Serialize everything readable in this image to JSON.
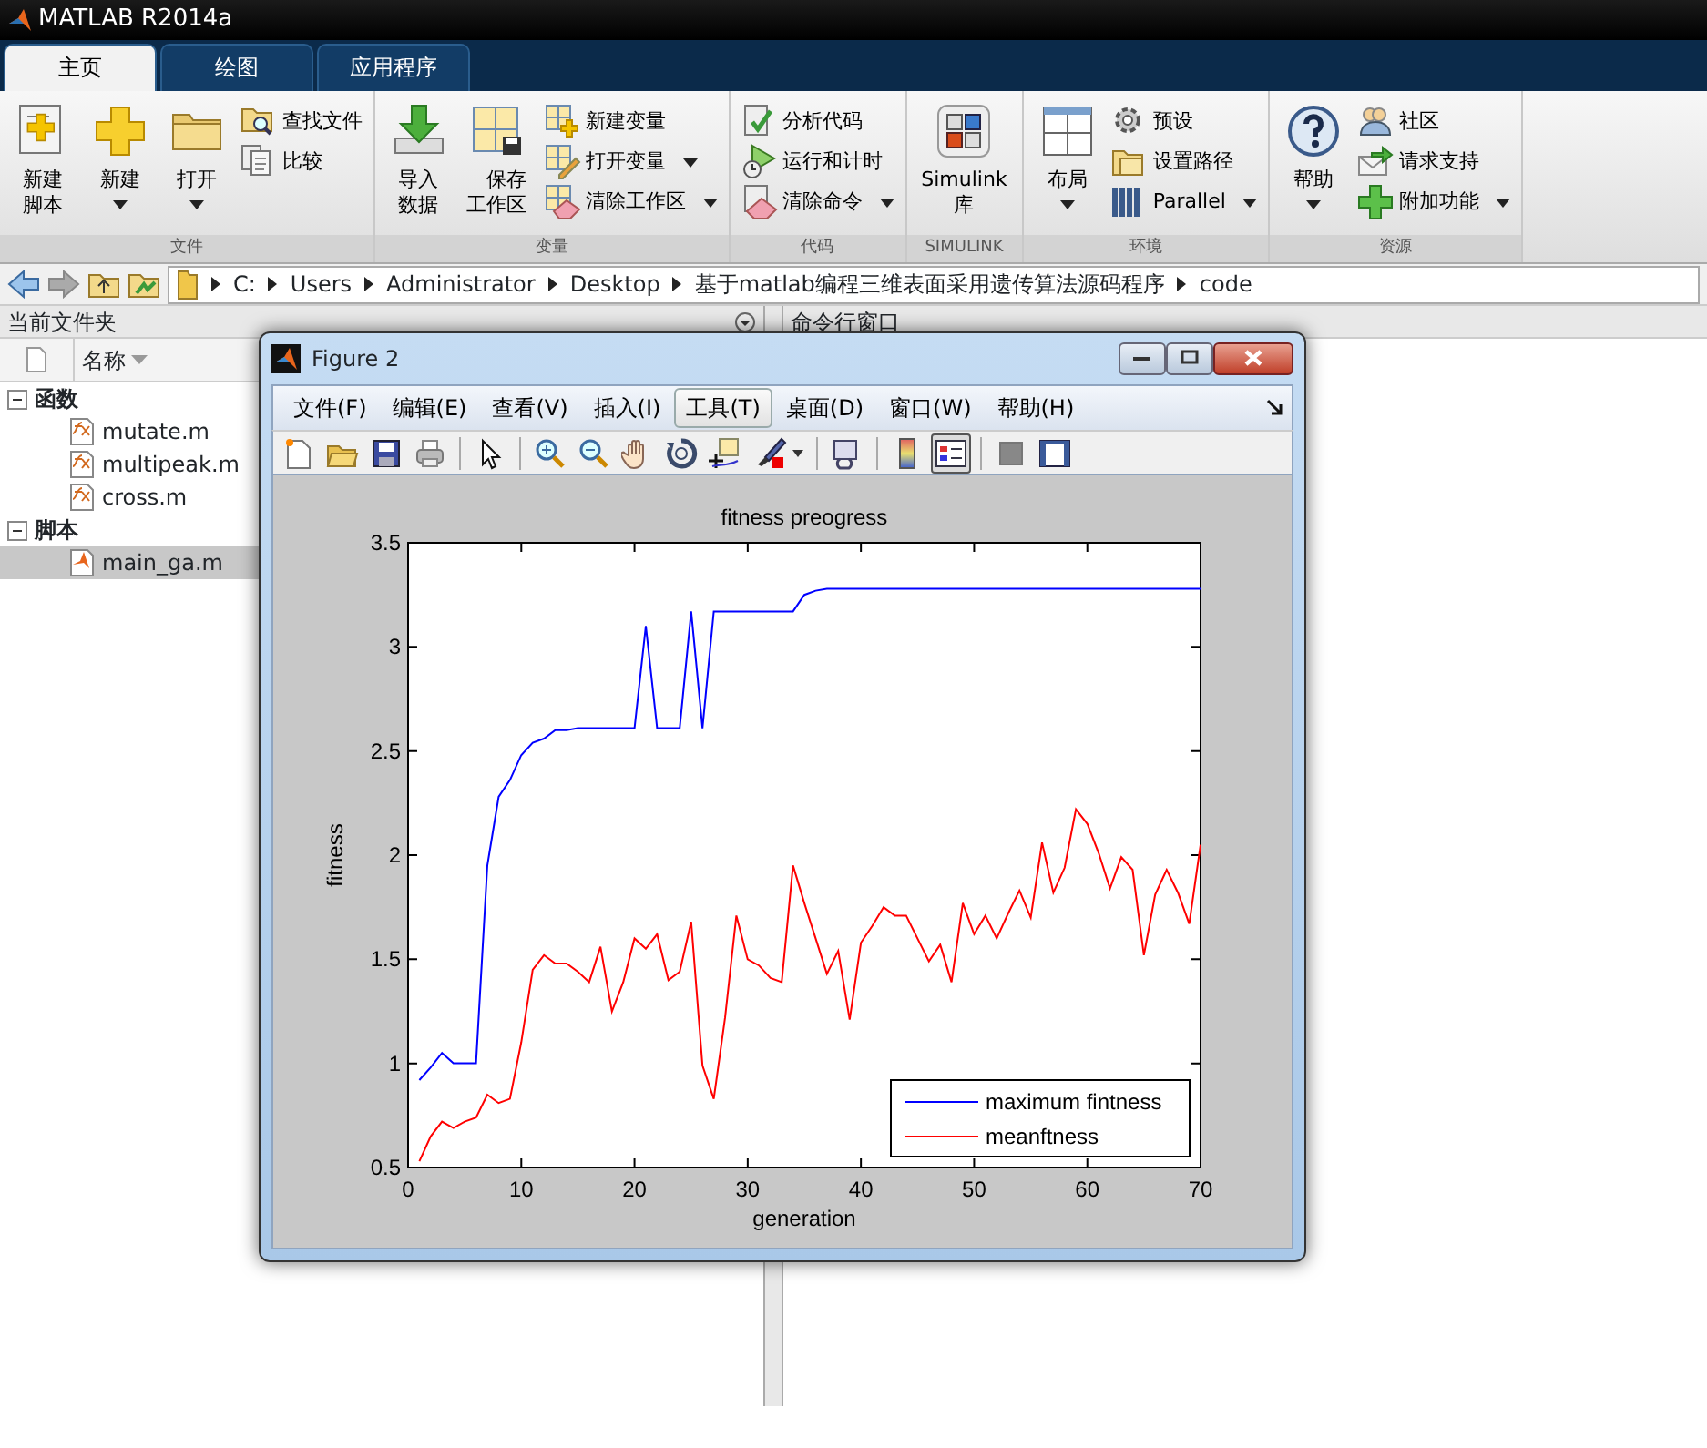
{
  "app": {
    "title": "MATLAB R2014a"
  },
  "tabs": [
    {
      "label": "主页",
      "selected": true
    },
    {
      "label": "绘图",
      "selected": false
    },
    {
      "label": "应用程序",
      "selected": false
    }
  ],
  "ribbon": [
    {
      "label": "文件",
      "items": [
        {
          "kind": "large",
          "label": "新建脚本",
          "dropdown": false
        },
        {
          "kind": "large",
          "label": "新建",
          "dropdown": true
        },
        {
          "kind": "large",
          "label": "打开",
          "dropdown": true
        },
        {
          "kind": "stack",
          "items": [
            {
              "label": "查找文件",
              "dropdown": false
            },
            {
              "label": "比较",
              "dropdown": false
            }
          ]
        }
      ]
    },
    {
      "label": "变量",
      "items": [
        {
          "kind": "large",
          "label": "导入数据",
          "dropdown": false
        },
        {
          "kind": "large",
          "label": "保存工作区",
          "dropdown": false
        },
        {
          "kind": "stack",
          "items": [
            {
              "label": "新建变量",
              "dropdown": false
            },
            {
              "label": "打开变量",
              "dropdown": true
            },
            {
              "label": "清除工作区",
              "dropdown": true
            }
          ]
        }
      ]
    },
    {
      "label": "代码",
      "items": [
        {
          "kind": "stack",
          "items": [
            {
              "label": "分析代码",
              "dropdown": false
            },
            {
              "label": "运行和计时",
              "dropdown": false
            },
            {
              "label": "清除命令",
              "dropdown": true
            }
          ]
        }
      ]
    },
    {
      "label": "SIMULINK",
      "items": [
        {
          "kind": "large",
          "label": "Simulink\n库",
          "dropdown": false
        }
      ]
    },
    {
      "label": "环境",
      "items": [
        {
          "kind": "large",
          "label": "布局",
          "dropdown": true
        },
        {
          "kind": "stack",
          "items": [
            {
              "label": "预设",
              "dropdown": false
            },
            {
              "label": "设置路径",
              "dropdown": false
            },
            {
              "label": "Parallel",
              "dropdown": true
            }
          ]
        }
      ]
    },
    {
      "label": "资源",
      "items": [
        {
          "kind": "large",
          "label": "帮助",
          "dropdown": true
        },
        {
          "kind": "stack",
          "items": [
            {
              "label": "社区",
              "dropdown": false
            },
            {
              "label": "请求支持",
              "dropdown": false
            },
            {
              "label": "附加功能",
              "dropdown": true
            }
          ]
        }
      ]
    }
  ],
  "path": [
    "C:",
    "Users",
    "Administrator",
    "Desktop",
    "基于matlab编程三维表面采用遗传算法源码程序",
    "code"
  ],
  "file_panel": {
    "title": "当前文件夹",
    "column": "名称",
    "tree": [
      {
        "label": "函数",
        "expanded": true,
        "children": [
          {
            "label": "mutate.m",
            "selected": false
          },
          {
            "label": "multipeak.m",
            "selected": false
          },
          {
            "label": "cross.m",
            "selected": false
          }
        ]
      },
      {
        "label": "脚本",
        "expanded": true,
        "children": [
          {
            "label": "main_ga.m",
            "selected": true
          }
        ]
      }
    ]
  },
  "command_panel": {
    "title": "命令行窗口"
  },
  "figure": {
    "title": "Figure 2",
    "menu": [
      {
        "label": "文件(F)",
        "highlighted": false
      },
      {
        "label": "编辑(E)",
        "highlighted": false
      },
      {
        "label": "查看(V)",
        "highlighted": false
      },
      {
        "label": "插入(I)",
        "highlighted": false
      },
      {
        "label": "工具(T)",
        "highlighted": true
      },
      {
        "label": "桌面(D)",
        "highlighted": false
      },
      {
        "label": "窗口(W)",
        "highlighted": false
      },
      {
        "label": "帮助(H)",
        "highlighted": false
      }
    ],
    "toolbar": [
      {
        "kind": "button",
        "pressed": false
      },
      {
        "kind": "button",
        "pressed": false
      },
      {
        "kind": "button",
        "pressed": false
      },
      {
        "kind": "button",
        "pressed": false
      },
      {
        "kind": "separator"
      },
      {
        "kind": "button",
        "pressed": false
      },
      {
        "kind": "separator"
      },
      {
        "kind": "button",
        "pressed": false
      },
      {
        "kind": "button",
        "pressed": false
      },
      {
        "kind": "button",
        "pressed": false
      },
      {
        "kind": "button",
        "pressed": false
      },
      {
        "kind": "button",
        "pressed": false
      },
      {
        "kind": "dropdown",
        "pressed": false
      },
      {
        "kind": "separator"
      },
      {
        "kind": "button",
        "pressed": false
      },
      {
        "kind": "separator"
      },
      {
        "kind": "button",
        "pressed": false
      },
      {
        "kind": "button",
        "pressed": true
      },
      {
        "kind": "separator"
      },
      {
        "kind": "button",
        "pressed": false
      },
      {
        "kind": "button",
        "pressed": false
      }
    ],
    "chart_data": {
      "type": "line",
      "title": "fitness preogress",
      "xlabel": "generation",
      "ylabel": "fitness",
      "x": [
        1,
        2,
        3,
        4,
        5,
        6,
        7,
        8,
        9,
        10,
        11,
        12,
        13,
        14,
        15,
        16,
        17,
        18,
        19,
        20,
        21,
        22,
        23,
        24,
        25,
        26,
        27,
        28,
        29,
        30,
        31,
        32,
        33,
        34,
        35,
        36,
        37,
        38,
        39,
        40,
        41,
        42,
        43,
        44,
        45,
        46,
        47,
        48,
        49,
        50,
        51,
        52,
        53,
        54,
        55,
        56,
        57,
        58,
        59,
        60,
        61,
        62,
        63,
        64,
        65,
        66,
        67,
        68,
        69,
        70
      ],
      "series": [
        {
          "name": "maximum fintness",
          "color": "#0000ff",
          "values": [
            0.92,
            0.98,
            1.05,
            1.0,
            1.0,
            1.0,
            1.95,
            2.28,
            2.36,
            2.48,
            2.54,
            2.56,
            2.6,
            2.6,
            2.61,
            2.61,
            2.61,
            2.61,
            2.61,
            2.61,
            3.1,
            2.61,
            2.61,
            2.61,
            3.17,
            2.61,
            3.17,
            3.17,
            3.17,
            3.17,
            3.17,
            3.17,
            3.17,
            3.17,
            3.25,
            3.27,
            3.28,
            3.28,
            3.28,
            3.28,
            3.28,
            3.28,
            3.28,
            3.28,
            3.28,
            3.28,
            3.28,
            3.28,
            3.28,
            3.28,
            3.28,
            3.28,
            3.28,
            3.28,
            3.28,
            3.28,
            3.28,
            3.28,
            3.28,
            3.28,
            3.28,
            3.28,
            3.28,
            3.28,
            3.28,
            3.28,
            3.28,
            3.28,
            3.28,
            3.28
          ]
        },
        {
          "name": "meanftness",
          "color": "#ff0000",
          "values": [
            0.53,
            0.65,
            0.72,
            0.69,
            0.72,
            0.74,
            0.85,
            0.81,
            0.83,
            1.1,
            1.45,
            1.52,
            1.48,
            1.48,
            1.44,
            1.39,
            1.56,
            1.25,
            1.39,
            1.6,
            1.55,
            1.62,
            1.4,
            1.44,
            1.68,
            0.99,
            0.83,
            1.22,
            1.71,
            1.5,
            1.47,
            1.41,
            1.39,
            1.95,
            1.77,
            1.6,
            1.43,
            1.54,
            1.21,
            1.58,
            1.66,
            1.75,
            1.71,
            1.71,
            1.6,
            1.49,
            1.57,
            1.39,
            1.77,
            1.62,
            1.71,
            1.6,
            1.72,
            1.83,
            1.7,
            2.06,
            1.82,
            1.94,
            2.22,
            2.15,
            2.01,
            1.84,
            1.99,
            1.93,
            1.52,
            1.81,
            1.93,
            1.82,
            1.67,
            2.05
          ]
        }
      ],
      "legend": true,
      "xlim": [
        0,
        70
      ],
      "ylim": [
        0.5,
        3.5
      ],
      "xticks": [
        0,
        10,
        20,
        30,
        40,
        50,
        60,
        70
      ],
      "yticks": [
        {
          "value": 0.5,
          "label": "0.5"
        },
        {
          "value": 1,
          "label": "1"
        },
        {
          "value": 1.5,
          "label": "1.5"
        },
        {
          "value": 2,
          "label": "2"
        },
        {
          "value": 2.5,
          "label": "2.5"
        },
        {
          "value": 3,
          "label": "3"
        },
        {
          "value": 3.5,
          "label": "3.5"
        }
      ]
    }
  }
}
